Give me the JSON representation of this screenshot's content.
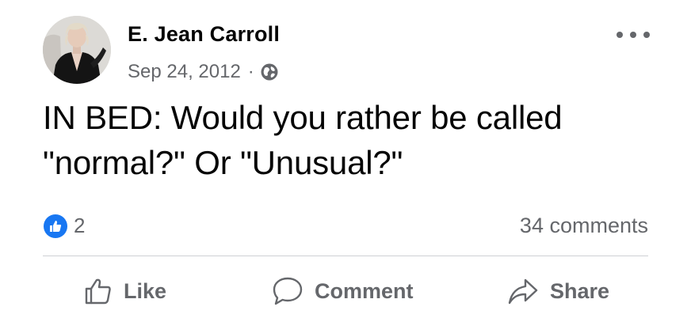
{
  "post": {
    "author": "E. Jean Carroll",
    "date": "Sep 24, 2012",
    "separator": "·",
    "privacy_icon": "globe-icon",
    "more_icon": "more-options-icon",
    "text": "IN BED: Would you rather be called \"normal?\" Or \"Unusual?\"",
    "reactions": {
      "icon": "like-reaction-icon",
      "count": "2"
    },
    "comments_count": "34 comments"
  },
  "actions": {
    "like_label": "Like",
    "comment_label": "Comment",
    "share_label": "Share"
  },
  "colors": {
    "primary_text": "#050505",
    "secondary_text": "#65676b",
    "like_blue": "#1877f2",
    "divider": "#ced0d4"
  }
}
